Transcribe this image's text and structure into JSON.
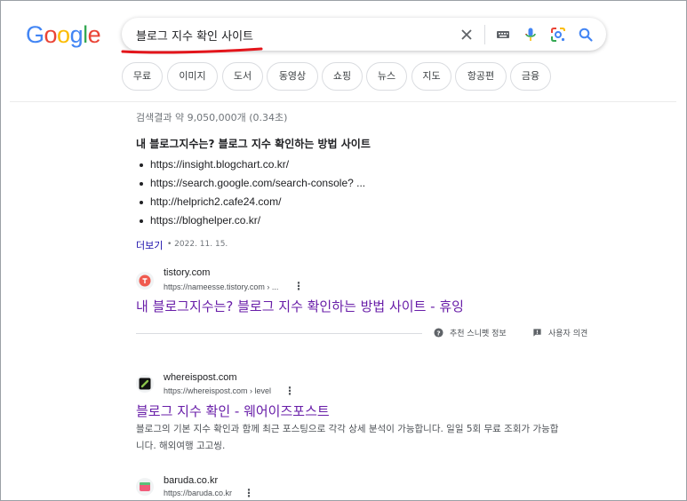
{
  "logo": {
    "letters": [
      "G",
      "o",
      "o",
      "g",
      "l",
      "e"
    ],
    "colors": [
      "#4285F4",
      "#EA4335",
      "#FBBC05",
      "#4285F4",
      "#34A853",
      "#EA4335"
    ]
  },
  "search": {
    "query": "블로그 지수 확인 사이트"
  },
  "icons": {
    "clear": "close-icon",
    "keyboard": "keyboard-icon",
    "voice": "microphone-icon",
    "lens": "lens-icon",
    "search": "search-icon"
  },
  "chips": [
    "무료",
    "이미지",
    "도서",
    "동영상",
    "쇼핑",
    "뉴스",
    "지도",
    "항공편",
    "금융"
  ],
  "stats": "검색결과 약 9,050,000개 (0.34초)",
  "snippet": {
    "title": "내 블로그지수는? 블로그 지수 확인하는 방법 사이트",
    "items": [
      "https://insight.blogchart.co.kr/",
      "https://search.google.com/search-console? ...",
      "http://helprich2.cafe24.com/",
      "https://bloghelper.co.kr/"
    ],
    "more_label": "더보기",
    "date": "• 2022. 11. 15."
  },
  "result1": {
    "site": "tistory.com",
    "url": "https://nameesse.tistory.com › ...",
    "title": "내 블로그지수는? 블로그 지수 확인하는 방법 사이트 - 휴잉"
  },
  "feedback": {
    "about_label": "추천 스니펫 정보",
    "feedback_label": "사용자 의견"
  },
  "result2": {
    "site": "whereispost.com",
    "url": "https://whereispost.com › level",
    "title": "블로그 지수 확인 - 웨어이즈포스트",
    "description": "블로그의 기본 지수 확인과 함께 최근 포스팅으로 각각 상세 분석이 가능합니다. 일일 5회 무료 조회가 가능합니다. 해외여행 고고씽."
  },
  "result3": {
    "site": "baruda.co.kr",
    "url": "https://baruda.co.kr"
  },
  "colors": {
    "link_visited": "#681da8",
    "link": "#1a0dab",
    "annotation_red": "#e3151b"
  }
}
